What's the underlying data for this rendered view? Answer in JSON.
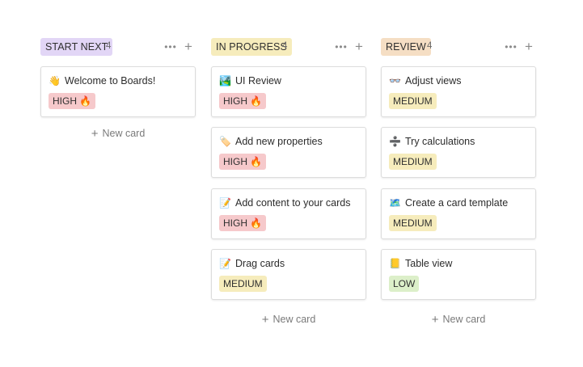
{
  "colors": {
    "start_next": "#e2d6f6",
    "in_progress": "#f6ecbc",
    "review": "#f5dec4",
    "high": "#f6c9cb",
    "medium": "#f6ecbc",
    "low": "#dcefc9"
  },
  "columns": [
    {
      "title": "START NEXT",
      "count": "4",
      "new_card_label": "New card",
      "cards": [
        {
          "emoji": "👋",
          "title": "Welcome to Boards!",
          "tag": "HIGH 🔥",
          "tag_type": "high"
        }
      ]
    },
    {
      "title": "IN PROGRESS",
      "count": "4",
      "new_card_label": "New card",
      "cards": [
        {
          "emoji": "🏞️",
          "title": "UI Review",
          "tag": "HIGH 🔥",
          "tag_type": "high"
        },
        {
          "emoji": "🏷️",
          "title": "Add new properties",
          "tag": "HIGH 🔥",
          "tag_type": "high"
        },
        {
          "emoji": "📝",
          "title": "Add content to your cards",
          "tag": "HIGH 🔥",
          "tag_type": "high"
        },
        {
          "emoji": "📝",
          "title": "Drag cards",
          "tag": "MEDIUM",
          "tag_type": "medium"
        }
      ]
    },
    {
      "title": "REVIEW",
      "count": "4",
      "new_card_label": "New card",
      "cards": [
        {
          "emoji": "👓",
          "title": "Adjust views",
          "tag": "MEDIUM",
          "tag_type": "medium"
        },
        {
          "emoji": "➗",
          "title": "Try calculations",
          "tag": "MEDIUM",
          "tag_type": "medium"
        },
        {
          "emoji": "🗺️",
          "title": "Create a card template",
          "tag": "MEDIUM",
          "tag_type": "medium"
        },
        {
          "emoji": "📒",
          "title": "Table view",
          "tag": "LOW",
          "tag_type": "low"
        }
      ]
    }
  ]
}
